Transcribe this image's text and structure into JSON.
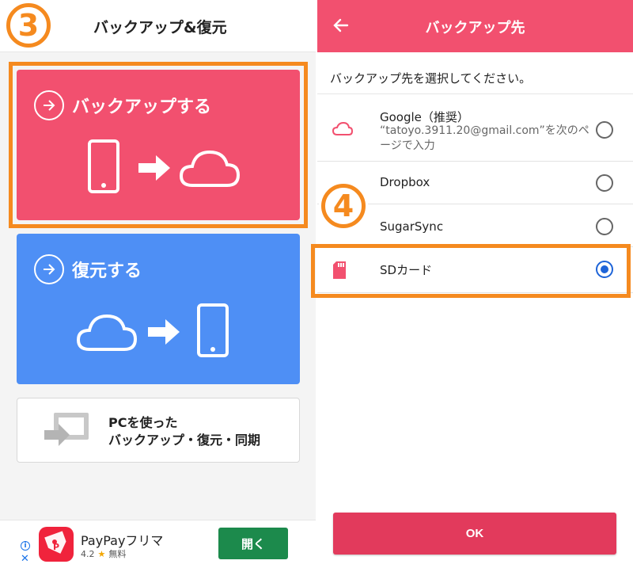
{
  "left": {
    "step_number": "3",
    "title": "バックアップ&復元",
    "backup_card": {
      "label": "バックアップする",
      "color": "#f2506f"
    },
    "restore_card": {
      "label": "復元する",
      "color": "#4e8ff5"
    },
    "pc_card": {
      "line1": "PCを使った",
      "line2": "バックアップ・復元・同期"
    },
    "ad": {
      "app_name": "PayPayフリマ",
      "rating": "4.2",
      "price": "無料",
      "open_label": "開く",
      "info_glyph": "i",
      "close_glyph": "✕"
    }
  },
  "right": {
    "title": "バックアップ先",
    "prompt": "バックアップ先を選択してください。",
    "step_number": "4",
    "options": [
      {
        "title": "Google（推奨）",
        "subtitle": "“tatoyo.3911.20@gmail.com”を次のページで入力",
        "selected": false
      },
      {
        "title": "Dropbox",
        "selected": false
      },
      {
        "title": "SugarSync",
        "selected": false
      },
      {
        "title": "SDカード",
        "selected": true
      }
    ],
    "ok_label": "OK"
  },
  "colors": {
    "accent_orange": "#f58a1f",
    "header_pink": "#f2506f",
    "radio_blue": "#1e64d8",
    "ok_red": "#e23a5c",
    "ad_green": "#1c8a4c"
  }
}
